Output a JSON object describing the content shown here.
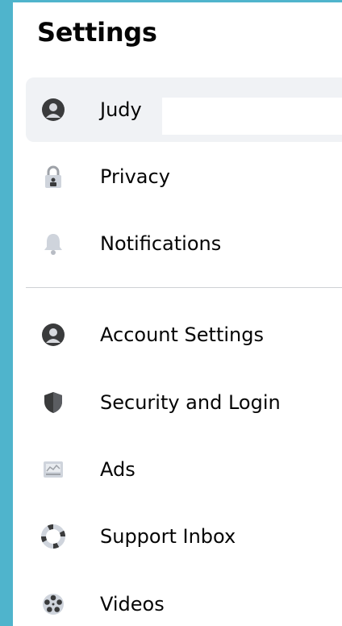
{
  "header": {
    "title": "Settings"
  },
  "menu_top": [
    {
      "label": "Judy",
      "icon": "profile-icon",
      "active": true
    },
    {
      "label": "Privacy",
      "icon": "lock-icon"
    },
    {
      "label": "Notifications",
      "icon": "bell-icon"
    }
  ],
  "menu_bottom": [
    {
      "label": "Account Settings",
      "icon": "account-icon"
    },
    {
      "label": "Security and Login",
      "icon": "shield-icon"
    },
    {
      "label": "Ads",
      "icon": "ads-icon"
    },
    {
      "label": "Support Inbox",
      "icon": "lifebuoy-icon"
    },
    {
      "label": "Videos",
      "icon": "film-reel-icon"
    }
  ],
  "colors": {
    "frame": "#4fb4cc",
    "icon_dark": "#3a3b3c",
    "icon_light": "#cfd4dc",
    "active_bg": "#f0f2f5"
  }
}
